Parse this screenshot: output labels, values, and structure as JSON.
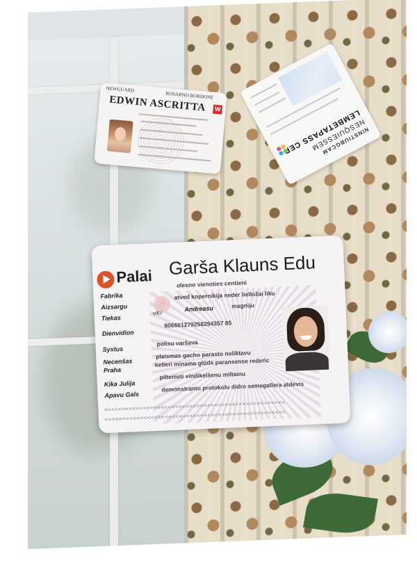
{
  "small_card": {
    "header_left": "NEWGUARD",
    "header_right": "ROSARNO BORDONE",
    "name": "EDWIN ASCRITTA",
    "logo_letter": "W"
  },
  "tilted_card": {
    "line1": "LEMBETAPASS CER",
    "line2": "NESQUIESSEM",
    "line3": "NINSTIUBGCAM",
    "dot_colors": [
      "#e84a8a",
      "#f2b233",
      "#3aa9d8",
      "#7cc24a"
    ]
  },
  "main_card": {
    "brand": "Palai",
    "title": "Garša Klauns Edu",
    "fields": [
      {
        "label": "Fabrika",
        "value": "olesno vienoties centieni"
      },
      {
        "label": "Aizsargu",
        "value": "atved kopernikija neder lielložai liku"
      },
      {
        "label": "Tiekas",
        "value": "magniju"
      },
      {
        "label": "Dienvidion",
        "value": "806661279258294357 85"
      },
      {
        "label": "Syxtus",
        "value": "polisu varšava"
      },
      {
        "label": "Necenšas",
        "value": "plaismas gacho parasto noliktavu"
      },
      {
        "label": "Praha",
        "value": "ketleri minama glūds paransense rederic"
      },
      {
        "label": "Kika Julija",
        "value": "piltenieti vindikelšenu miltainu"
      },
      {
        "label": "Apavu Gals",
        "value": "demonstrantu protokolu didro semegallera atdevis"
      }
    ],
    "signature_small": "vilci",
    "signature_name": "Andreasu",
    "mrz_line1": "<<<<<<<<<<<<<<<<<<<<<<<<<<<<<<<<<<<<<<<<<<<<<<<<<<<",
    "mrz_line2": "<<<<<<<<<<<<<<<<<<<<<<<<<<<<<<<<<<<<<<<<<<<<<<<<<<<"
  }
}
